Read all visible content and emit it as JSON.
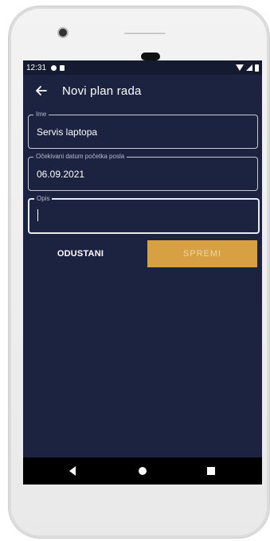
{
  "status_bar": {
    "time": "12:31"
  },
  "app_bar": {
    "title": "Novi plan rada"
  },
  "form": {
    "name": {
      "label": "Ime",
      "value": "Servis laptopa"
    },
    "start_date": {
      "label": "Očekivani datum početka posla",
      "value": "06.09.2021"
    },
    "description": {
      "label": "Opis",
      "value": ""
    }
  },
  "actions": {
    "cancel": "ODUSTANI",
    "save": "SPREMI"
  },
  "colors": {
    "background": "#1c2340",
    "accent": "#d6a043"
  },
  "icons": [
    "back-arrow-icon",
    "nav-back-icon",
    "nav-home-icon",
    "nav-recent-icon"
  ]
}
